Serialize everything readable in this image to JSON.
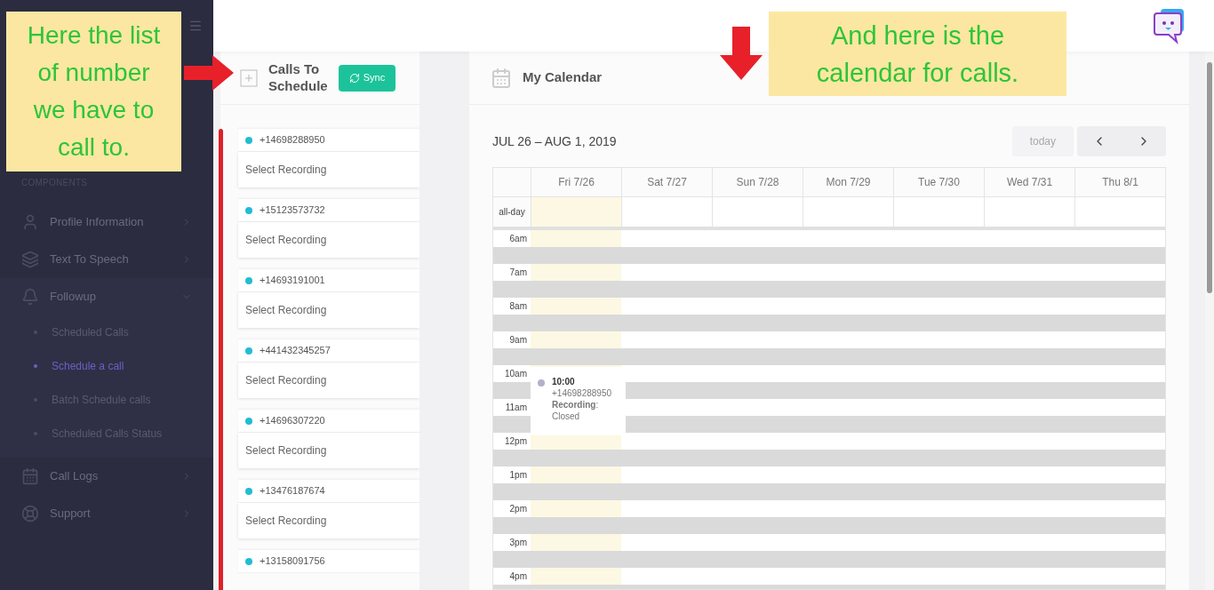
{
  "annotations": [
    {
      "kind": "left",
      "text": "Here the list of number we have to call to."
    },
    {
      "kind": "right",
      "text": "And here is the calendar for calls."
    }
  ],
  "sidebar": {
    "section_label": "COMPONENTS",
    "items": [
      {
        "label": "Profile Information",
        "expanded": false
      },
      {
        "label": "Text To Speech",
        "expanded": false
      },
      {
        "label": "Followup",
        "expanded": true,
        "children": [
          {
            "label": "Scheduled Calls",
            "selected": false
          },
          {
            "label": "Schedule a call",
            "selected": true
          },
          {
            "label": "Batch Schedule calls",
            "selected": false
          },
          {
            "label": "Scheduled Calls Status",
            "selected": false
          }
        ]
      },
      {
        "label": "Call Logs",
        "expanded": false
      },
      {
        "label": "Support",
        "expanded": false
      }
    ]
  },
  "calls_panel": {
    "title": "Calls To Schedule",
    "sync_button": "Sync",
    "calls": [
      {
        "number": "+14698288950",
        "recording_placeholder": "Select Recording"
      },
      {
        "number": "+15123573732",
        "recording_placeholder": "Select Recording"
      },
      {
        "number": "+14693191001",
        "recording_placeholder": "Select Recording"
      },
      {
        "number": "+441432345257",
        "recording_placeholder": "Select Recording"
      },
      {
        "number": "+14696307220",
        "recording_placeholder": "Select Recording"
      },
      {
        "number": "+13476187674",
        "recording_placeholder": "Select Recording"
      },
      {
        "number": "+13158091756"
      }
    ]
  },
  "calendar": {
    "title": "My Calendar",
    "range": "JUL 26 – AUG 1, 2019",
    "today_button": {
      "label": "today",
      "disabled": true
    },
    "days": [
      {
        "label": "Fri 7/26",
        "today": true
      },
      {
        "label": "Sat 7/27",
        "today": false
      },
      {
        "label": "Sun 7/28",
        "today": false
      },
      {
        "label": "Mon 7/29",
        "today": false
      },
      {
        "label": "Tue 7/30",
        "today": false
      },
      {
        "label": "Wed 7/31",
        "today": false
      },
      {
        "label": "Thu 8/1",
        "today": false
      }
    ],
    "all_day_label": "all-day",
    "hours": [
      "6am",
      "7am",
      "8am",
      "9am",
      "10am",
      "11am",
      "12pm",
      "1pm",
      "2pm",
      "3pm",
      "4pm"
    ],
    "event": {
      "time": "10:00",
      "number": "+14698288950",
      "detail": "**Recording**: Closed"
    }
  }
}
